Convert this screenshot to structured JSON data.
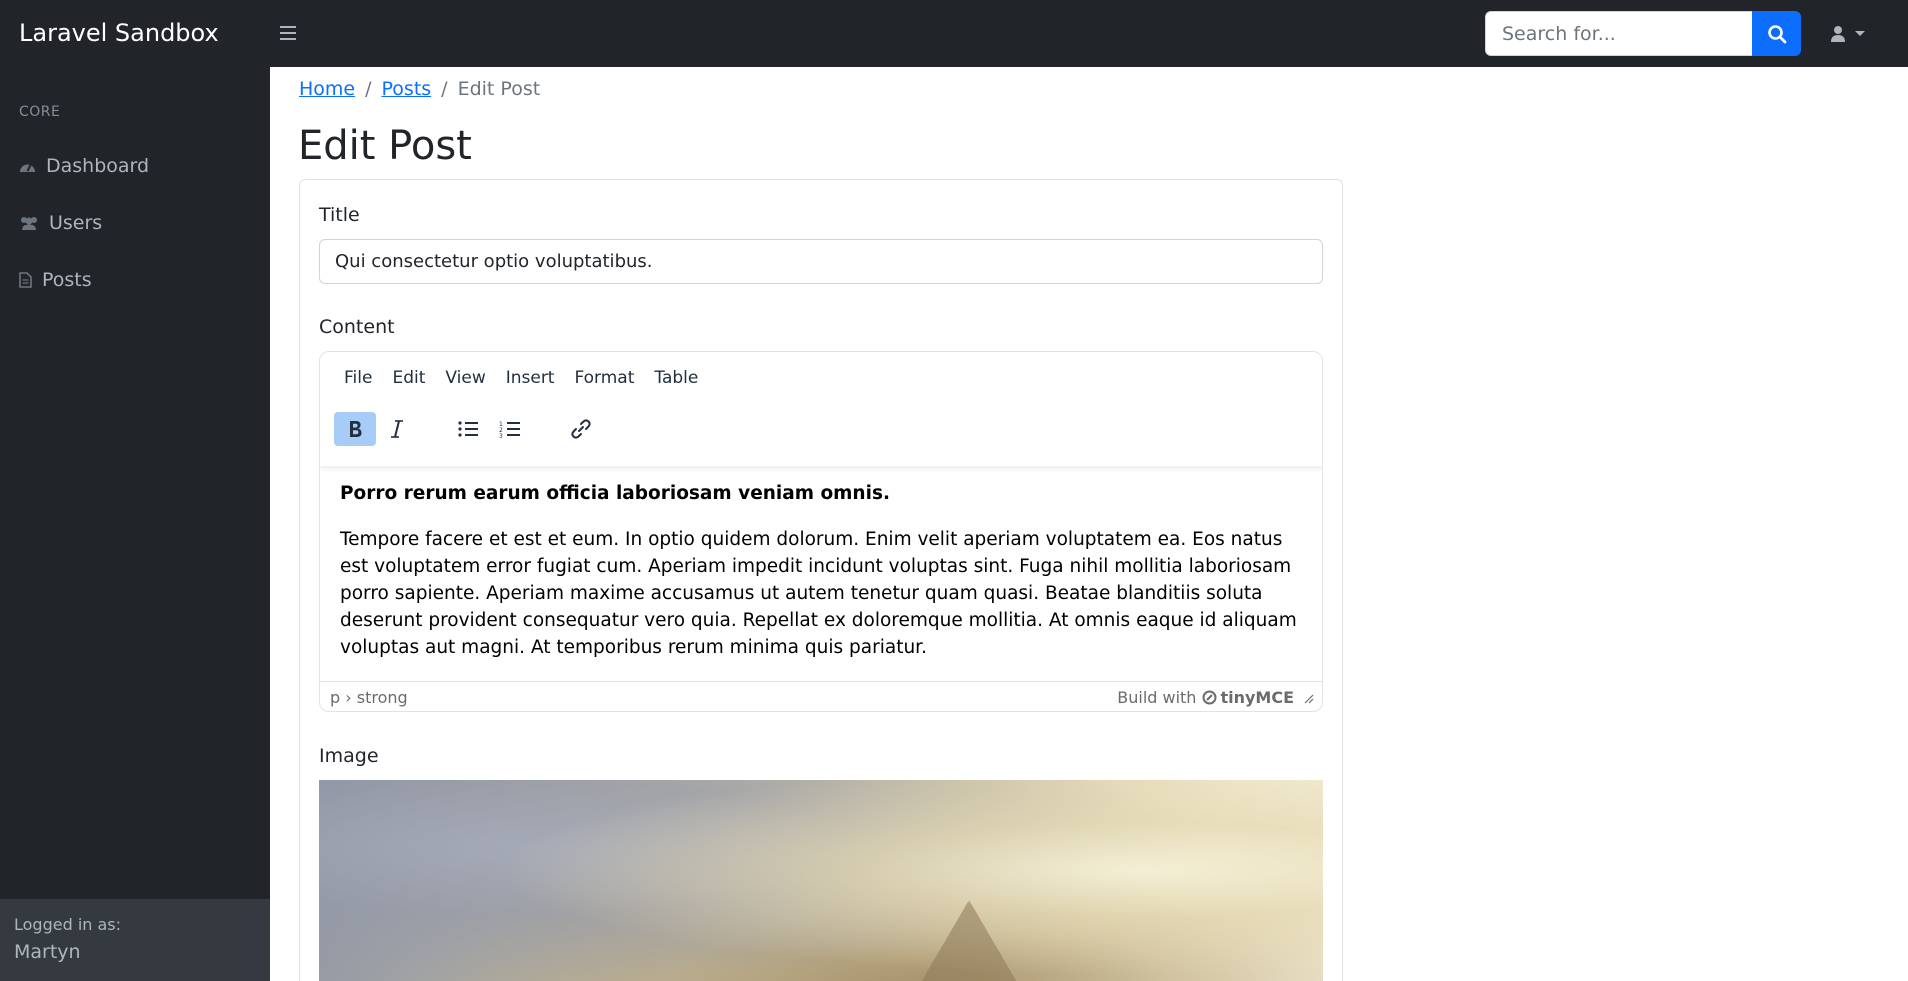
{
  "app": {
    "brand": "Laravel Sandbox"
  },
  "topbar": {
    "search_placeholder": "Search for...",
    "icons": [
      "bars-icon",
      "search-icon",
      "user-icon",
      "caret-down-icon"
    ]
  },
  "sidebar": {
    "heading": "CORE",
    "items": [
      {
        "label": "Dashboard",
        "icon": "tachometer-icon"
      },
      {
        "label": "Users",
        "icon": "users-icon"
      },
      {
        "label": "Posts",
        "icon": "file-icon"
      }
    ],
    "footer": {
      "logged_in_label": "Logged in as:",
      "user_name": "Martyn"
    }
  },
  "breadcrumb": {
    "items": [
      "Home",
      "Posts"
    ],
    "current": "Edit Post"
  },
  "page": {
    "title": "Edit Post"
  },
  "form": {
    "title_label": "Title",
    "title_value": "Qui consectetur optio voluptatibus.",
    "content_label": "Content",
    "image_label": "Image"
  },
  "editor": {
    "menu": [
      "File",
      "Edit",
      "View",
      "Insert",
      "Format",
      "Table"
    ],
    "toolbar": [
      {
        "name": "bold",
        "icon": "bold-icon",
        "active": true
      },
      {
        "name": "italic",
        "icon": "italic-icon",
        "active": false
      },
      {
        "name": "bullet-list",
        "icon": "bullet-list-icon",
        "active": false
      },
      {
        "name": "numbered-list",
        "icon": "numbered-list-icon",
        "active": false
      },
      {
        "name": "link",
        "icon": "link-icon",
        "active": false
      }
    ],
    "content_bold": "Porro rerum earum officia laboriosam veniam omnis.",
    "content_paragraph": "Tempore facere et est et eum. In optio quidem dolorum. Enim velit aperiam voluptatem ea. Eos natus est voluptatem error fugiat cum. Aperiam impedit incidunt voluptas sint. Fuga nihil mollitia laboriosam porro sapiente. Aperiam maxime accusamus ut autem tenetur quam quasi. Beatae blanditiis soluta deserunt provident consequatur vero quia. Repellat ex doloremque mollitia. At omnis eaque id aliquam voluptas aut magni. At temporibus rerum minima quis pariatur.",
    "status_path": "p › strong",
    "build_with": "Build with",
    "brand": "tinyMCE"
  },
  "colors": {
    "navbar": "#212529",
    "primary": "#0d6efd",
    "active_toolbar": "#a6ccf7"
  }
}
